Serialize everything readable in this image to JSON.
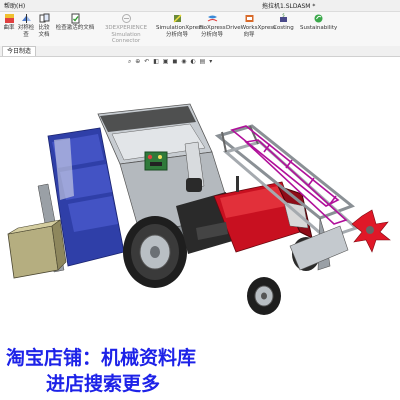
{
  "window": {
    "menu_label": "帮助(H)",
    "title": "拖拉机1.SLDASM *"
  },
  "ribbon": {
    "items": [
      {
        "label": "曲率"
      },
      {
        "label": "对称检查"
      },
      {
        "label": "比较文档"
      },
      {
        "label": "检查激活的文档"
      },
      {
        "label": "3DEXPERIENCE Simulation Connector"
      },
      {
        "label": "SimulationXpress 分析向导"
      },
      {
        "label": "FloXpress 分析向导"
      },
      {
        "label": "DriveWorksXpress 向导"
      },
      {
        "label": "Costing"
      },
      {
        "label": "Sustainability"
      }
    ]
  },
  "tabs": [
    {
      "label": "今日制造"
    }
  ],
  "view_toolbar_icons": [
    "zoom-fit-icon",
    "zoom-area-icon",
    "previous-view-icon",
    "section-view-icon",
    "view-orientation-icon",
    "display-style-icon",
    "hide-show-icon",
    "appearance-icon",
    "scene-icon",
    "display-settings-icon"
  ],
  "watermark": {
    "line1": "淘宝店铺：机械资料库",
    "line2": "进店搜索更多"
  },
  "colors": {
    "tractor_body": "#c81020",
    "frame": "#9aa0a6",
    "harvester_blue": "#2f3fa8",
    "cutter_red": "#e01828",
    "tube_magenta": "#b0109a",
    "watermark": "#1d22e8"
  }
}
